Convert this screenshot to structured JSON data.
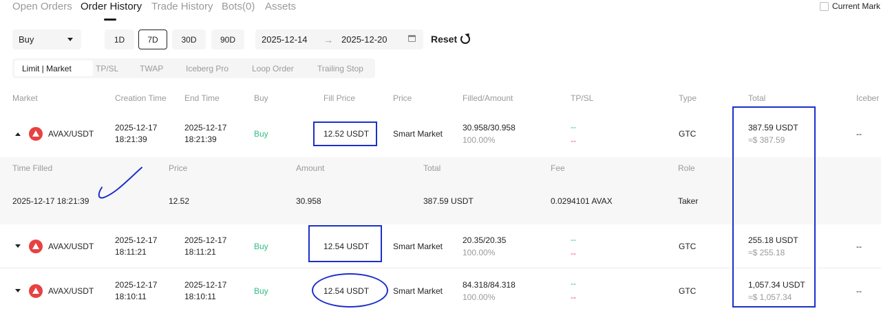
{
  "top_tabs": [
    {
      "label": "Open Orders"
    },
    {
      "label": "Order History"
    },
    {
      "label": "Trade History"
    },
    {
      "label": "Bots(0)"
    },
    {
      "label": "Assets"
    }
  ],
  "current_mark_label": "Current Mark",
  "filters": {
    "side": "Buy",
    "periods": [
      "1D",
      "7D",
      "30D",
      "90D"
    ],
    "active_period": "7D",
    "date_start": "2025-12-14",
    "date_end": "2025-12-20",
    "reset_label": "Reset"
  },
  "order_types": [
    "Limit | Market",
    "TP/SL",
    "TWAP",
    "Iceberg Pro",
    "Loop Order",
    "Trailing Stop"
  ],
  "columns": [
    "Market",
    "Creation Time",
    "End Time",
    "Buy",
    "Fill Price",
    "Price",
    "Filled/Amount",
    "TP/SL",
    "Type",
    "Total",
    "Iceber"
  ],
  "orders": [
    {
      "market": "AVAX/USDT",
      "creation_date": "2025-12-17",
      "creation_time": "18:21:39",
      "end_date": "2025-12-17",
      "end_time": "18:21:39",
      "side": "Buy",
      "fill_price": "12.52 USDT",
      "price": "Smart Market",
      "filled": "30.958/30.958",
      "filled_pct": "100.00%",
      "tp": "--",
      "sl": "--",
      "type": "GTC",
      "total": "387.59 USDT",
      "total_usd": "≈$ 387.59",
      "iceberg": "--",
      "expanded": true
    },
    {
      "market": "AVAX/USDT",
      "creation_date": "2025-12-17",
      "creation_time": "18:11:21",
      "end_date": "2025-12-17",
      "end_time": "18:11:21",
      "side": "Buy",
      "fill_price": "12.54 USDT",
      "price": "Smart Market",
      "filled": "20.35/20.35",
      "filled_pct": "100.00%",
      "tp": "--",
      "sl": "--",
      "type": "GTC",
      "total": "255.18 USDT",
      "total_usd": "≈$ 255.18",
      "iceberg": "--",
      "expanded": false
    },
    {
      "market": "AVAX/USDT",
      "creation_date": "2025-12-17",
      "creation_time": "18:10:11",
      "end_date": "2025-12-17",
      "end_time": "18:10:11",
      "side": "Buy",
      "fill_price": "12.54 USDT",
      "price": "Smart Market",
      "filled": "84.318/84.318",
      "filled_pct": "100.00%",
      "tp": "--",
      "sl": "--",
      "type": "GTC",
      "total": "1,057.34 USDT",
      "total_usd": "≈$ 1,057.34",
      "iceberg": "--",
      "expanded": false
    }
  ],
  "fill_detail": {
    "headers": [
      "Time Filled",
      "Price",
      "Amount",
      "Total",
      "Fee",
      "Role"
    ],
    "values": [
      "2025-12-17 18:21:39",
      "12.52",
      "30.958",
      "387.59 USDT",
      "0.0294101 AVAX",
      "Taker"
    ]
  },
  "colors": {
    "buy": "#2ebd85",
    "take_profit": "#2ebd85",
    "stop_loss": "#f6465d",
    "avax": "#e84142",
    "annotation": "#1a2fc9"
  }
}
